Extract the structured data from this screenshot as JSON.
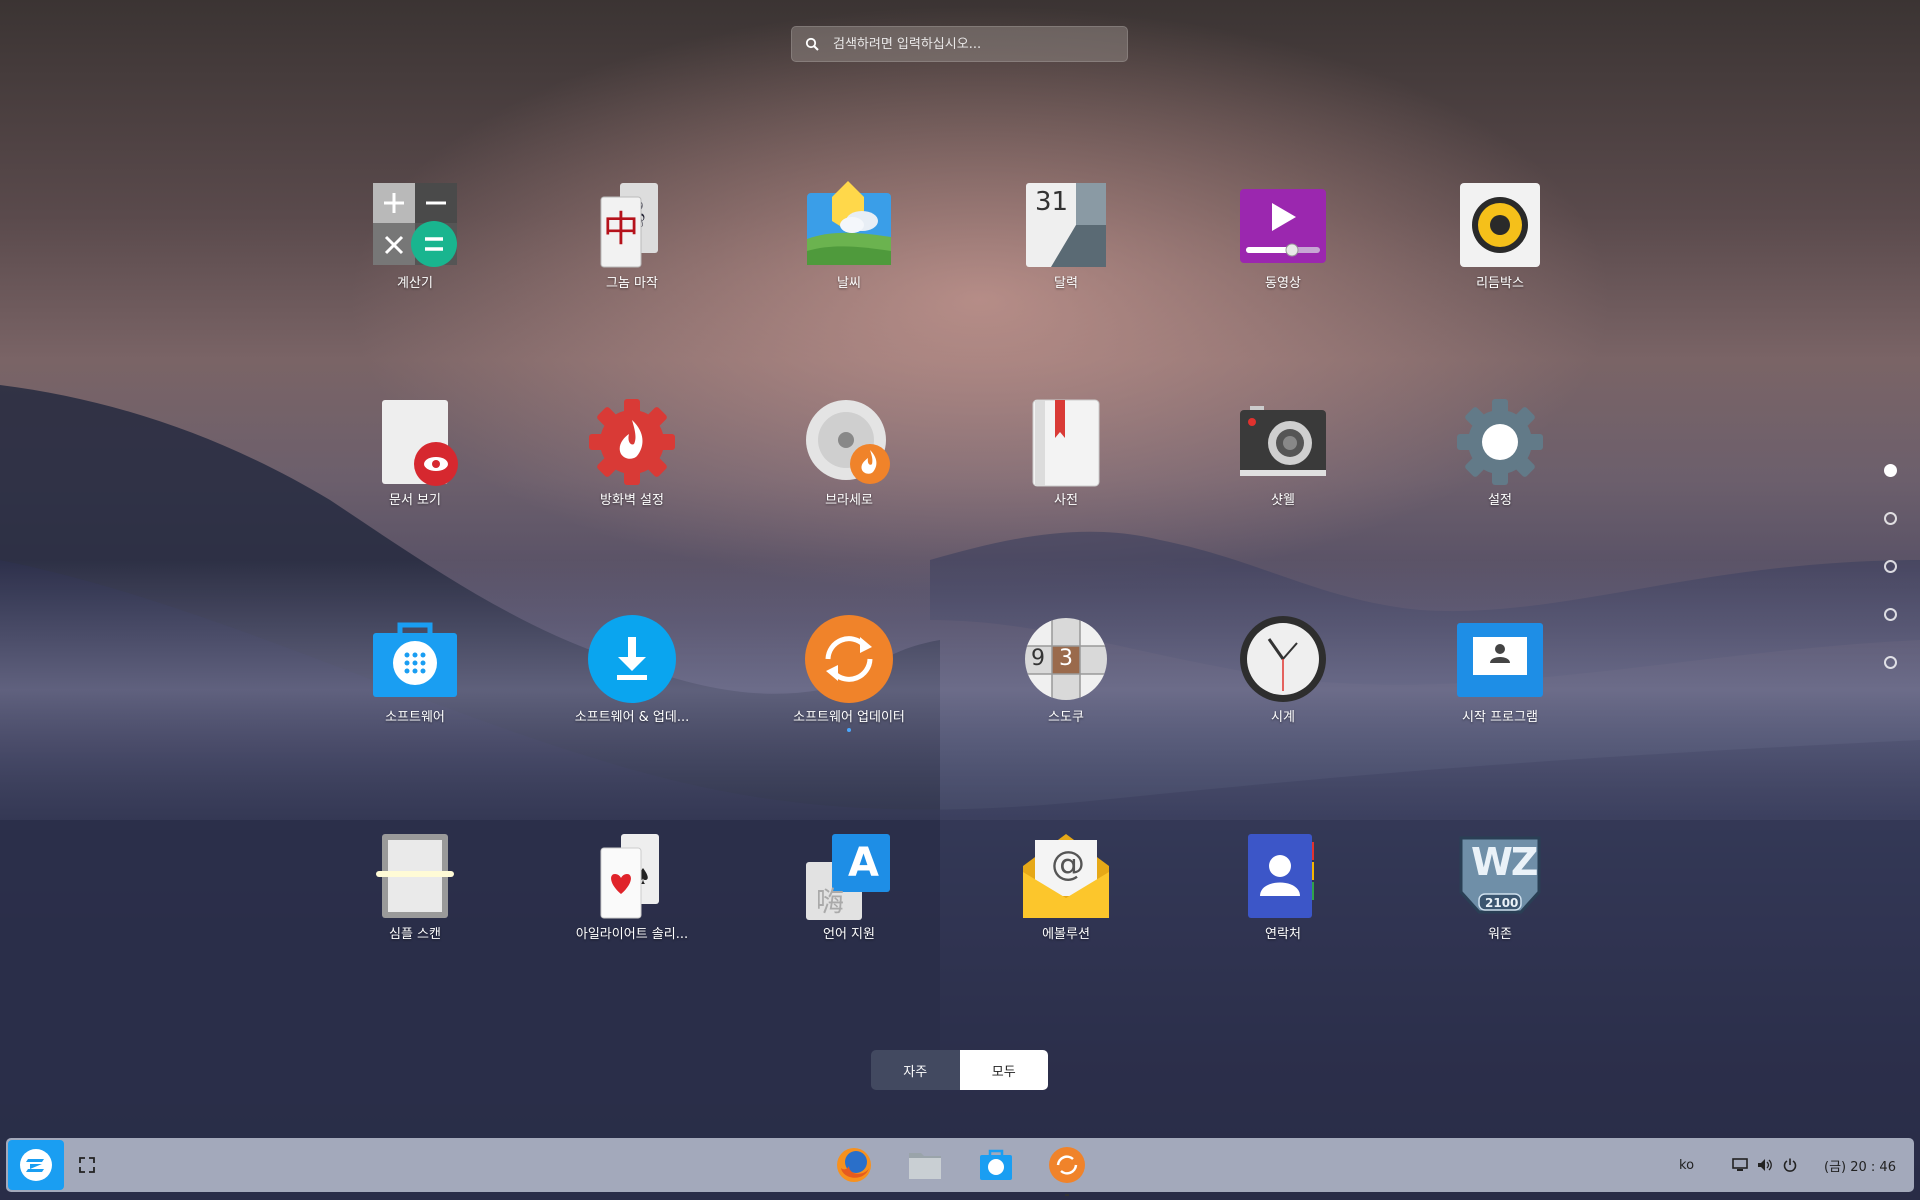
{
  "search": {
    "placeholder": "검색하려면 입력하십시오..."
  },
  "apps": [
    {
      "label": "계산기",
      "icon": "calculator-icon"
    },
    {
      "label": "그놈 마작",
      "icon": "mahjong-icon"
    },
    {
      "label": "날씨",
      "icon": "weather-icon"
    },
    {
      "label": "달력",
      "icon": "calendar-icon",
      "day": "31"
    },
    {
      "label": "동영상",
      "icon": "video-player-icon"
    },
    {
      "label": "리듬박스",
      "icon": "rhythmbox-icon"
    },
    {
      "label": "문서 보기",
      "icon": "document-viewer-icon"
    },
    {
      "label": "방화벽 설정",
      "icon": "firewall-icon"
    },
    {
      "label": "브라세로",
      "icon": "brasero-icon"
    },
    {
      "label": "사전",
      "icon": "dictionary-icon"
    },
    {
      "label": "샷웰",
      "icon": "shotwell-icon"
    },
    {
      "label": "설정",
      "icon": "settings-gear-icon"
    },
    {
      "label": "소프트웨어",
      "icon": "software-store-icon"
    },
    {
      "label": "소프트웨어 & 업데...",
      "icon": "software-updates-icon"
    },
    {
      "label": "소프트웨어 업데이터",
      "icon": "software-updater-icon",
      "running": true
    },
    {
      "label": "스도쿠",
      "icon": "sudoku-icon",
      "digits": [
        "9",
        "3"
      ]
    },
    {
      "label": "시계",
      "icon": "clock-icon"
    },
    {
      "label": "시작 프로그램",
      "icon": "startup-apps-icon"
    },
    {
      "label": "심플 스캔",
      "icon": "simple-scan-icon"
    },
    {
      "label": "아일라이어트 솔리...",
      "icon": "aisleriot-cards-icon"
    },
    {
      "label": "언어 지원",
      "icon": "language-support-icon",
      "glyphs": [
        "A",
        "嗨"
      ]
    },
    {
      "label": "에볼루션",
      "icon": "evolution-mail-icon",
      "glyph": "@"
    },
    {
      "label": "연락처",
      "icon": "contacts-icon"
    },
    {
      "label": "워존",
      "icon": "warzone-icon",
      "logo_text": [
        "WZ",
        "2100"
      ]
    }
  ],
  "pager": {
    "pages": 5,
    "active": 1
  },
  "view_toggle": {
    "frequent": "자주",
    "all": "모두",
    "selected": "all"
  },
  "taskbar": {
    "pinned": [
      {
        "name": "firefox-icon"
      },
      {
        "name": "files-icon"
      },
      {
        "name": "software-store-icon"
      },
      {
        "name": "software-updater-icon",
        "running": true
      }
    ],
    "language": "ko",
    "clock": "(금) 20 : 46"
  },
  "colors": {
    "accent": "#1a9ef2",
    "orange": "#f0832a",
    "red": "#d93a36"
  }
}
